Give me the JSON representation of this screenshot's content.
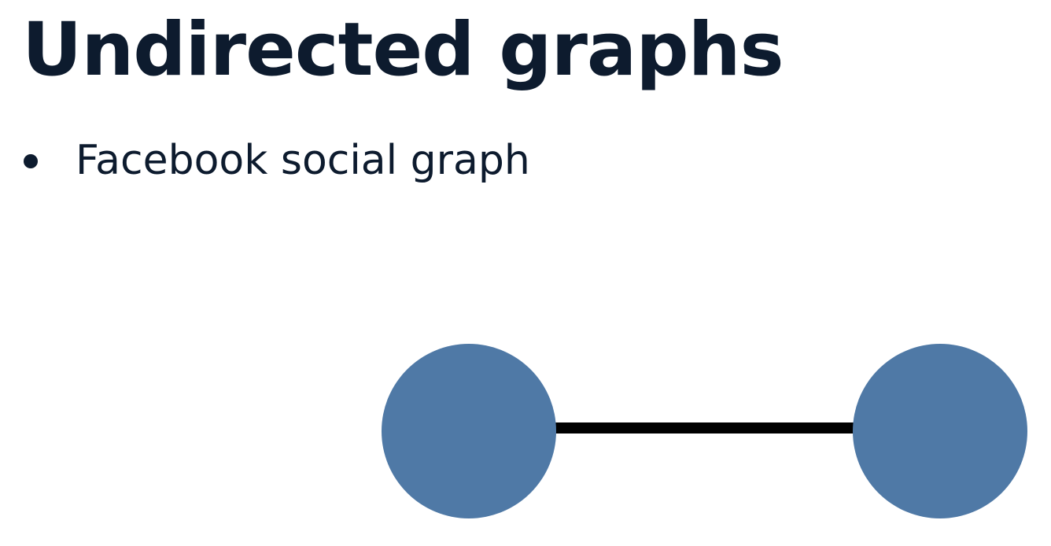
{
  "slide": {
    "title": "Undirected graphs",
    "bullets": [
      {
        "text": "Facebook social graph"
      }
    ]
  },
  "colors": {
    "text": "#0d1b2e",
    "node_fill": "#4f79a6",
    "edge": "#000000",
    "background": "#ffffff"
  },
  "diagram": {
    "nodes": [
      {
        "id": "a",
        "label": ""
      },
      {
        "id": "b",
        "label": ""
      }
    ],
    "edges": [
      {
        "from": "a",
        "to": "b",
        "directed": false
      }
    ]
  }
}
